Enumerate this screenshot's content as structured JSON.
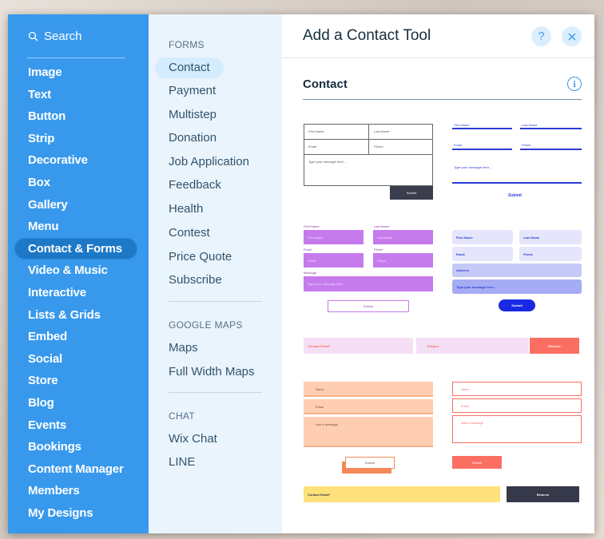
{
  "sidebar": {
    "search_label": "Search",
    "categories": [
      "Image",
      "Text",
      "Button",
      "Strip",
      "Decorative",
      "Box",
      "Gallery",
      "Menu",
      "Contact & Forms",
      "Video & Music",
      "Interactive",
      "Lists & Grids",
      "Embed",
      "Social",
      "Store",
      "Blog",
      "Events",
      "Bookings",
      "Content Manager",
      "Members",
      "My Designs"
    ],
    "selected": "Contact & Forms"
  },
  "subnav": {
    "forms_heading": "FORMS",
    "forms": [
      "Contact",
      "Payment",
      "Multistep",
      "Donation",
      "Job Application",
      "Feedback",
      "Health",
      "Contest",
      "Price Quote",
      "Subscribe"
    ],
    "maps_heading": "GOOGLE MAPS",
    "maps": [
      "Maps",
      "Full Width Maps"
    ],
    "chat_heading": "CHAT",
    "chat": [
      "Wix Chat",
      "LINE"
    ],
    "selected": "Contact"
  },
  "panel": {
    "title": "Add a Contact Tool",
    "help_icon": "question-icon",
    "close_icon": "close-icon",
    "section_title": "Contact",
    "info_icon": "info-icon"
  },
  "templates": {
    "t1": {
      "first": "First Name",
      "last": "Last Name",
      "email": "Email",
      "phone": "Phone",
      "message": "Type your message here...",
      "submit": "Submit"
    },
    "t2": {
      "first": "First Name",
      "last": "Last Name",
      "email": "Email",
      "phone": "Phone",
      "message": "Type your message here...",
      "submit": "Submit"
    },
    "t3": {
      "first_label": "First Name",
      "last_label": "Last Name",
      "first_ph": "First Name",
      "last_ph": "Last Name",
      "email_label": "Email",
      "phone_label": "Phone",
      "email_ph": "Email",
      "phone_ph": "Phone",
      "message_label": "Message",
      "message_ph": "Type your message here",
      "submit": "Submit"
    },
    "t4": {
      "first": "First Name",
      "last": "Last Name",
      "email": "Email",
      "phone": "Phone",
      "address": "Address",
      "message": "Type your message here...",
      "submit": "Submit"
    },
    "t5": {
      "email": "Contact Email*",
      "subject": "Subject",
      "button": "Reserve"
    },
    "t6": {
      "name": "Name",
      "email": "Email",
      "message": "Add a message",
      "submit": "Submit"
    },
    "t7": {
      "name": "Name",
      "email": "Email",
      "message": "Add a message",
      "submit": "Submit"
    },
    "t8": {
      "email": "Contact Email*",
      "button": "Reserve"
    }
  },
  "colors": {
    "sidebar": "#3899ec",
    "subnav": "#eaf4fd",
    "purple": "#c57bec",
    "navy": "#2b3cd6",
    "lavender": "#e5e6fb",
    "coral": "#fb6f63",
    "peach": "#ffcdb2",
    "yellow": "#fee17a",
    "dark": "#36394a"
  }
}
